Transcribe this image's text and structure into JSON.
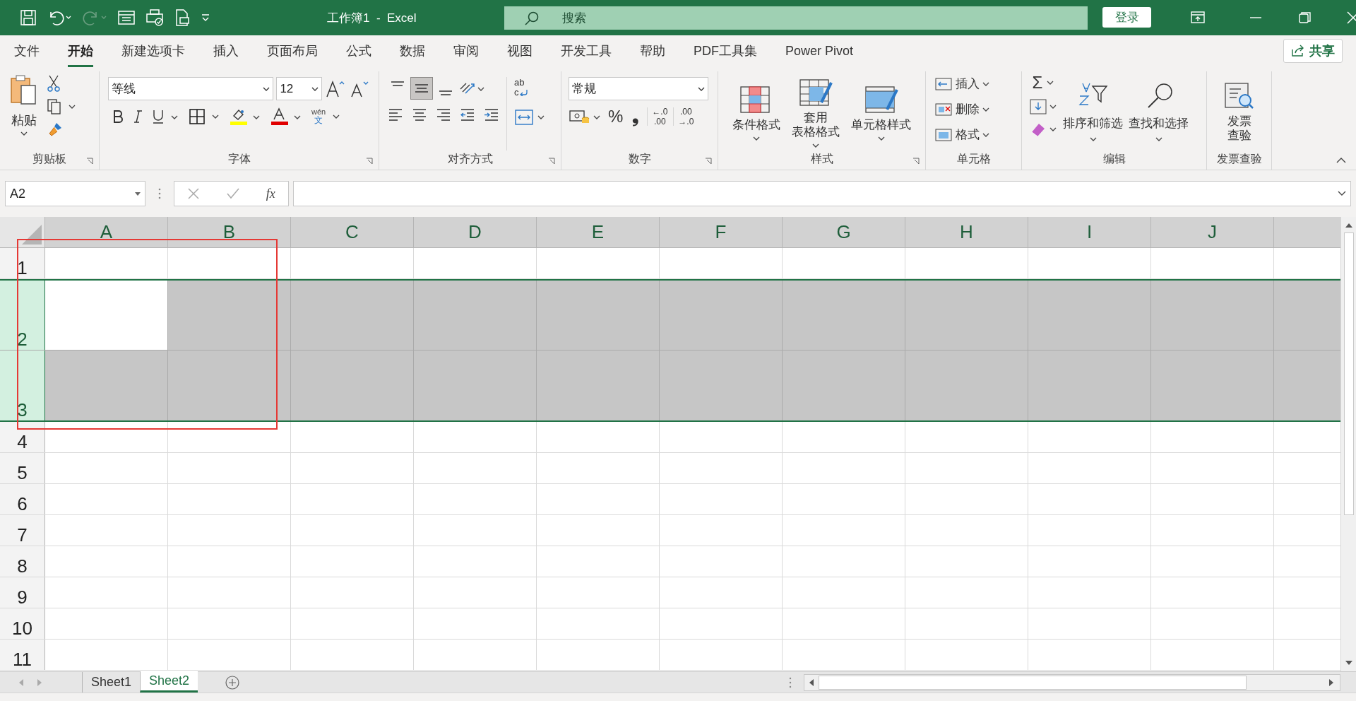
{
  "title_bar": {
    "title": "工作簿1  -  Excel",
    "search_placeholder": "搜索",
    "sign_in": "登录"
  },
  "ribbon_tabs": [
    {
      "label": "文件",
      "selected": false
    },
    {
      "label": "开始",
      "selected": true
    },
    {
      "label": "新建选项卡",
      "selected": false
    },
    {
      "label": "插入",
      "selected": false
    },
    {
      "label": "页面布局",
      "selected": false
    },
    {
      "label": "公式",
      "selected": false
    },
    {
      "label": "数据",
      "selected": false
    },
    {
      "label": "审阅",
      "selected": false
    },
    {
      "label": "视图",
      "selected": false
    },
    {
      "label": "开发工具",
      "selected": false
    },
    {
      "label": "帮助",
      "selected": false
    },
    {
      "label": "PDF工具集",
      "selected": false
    },
    {
      "label": "Power Pivot",
      "selected": false
    }
  ],
  "share": "共享",
  "clipboard": {
    "paste": "粘贴",
    "label": "剪贴板"
  },
  "font": {
    "font_name": "等线",
    "font_size": "12",
    "phonetic_top": "wén",
    "phonetic_bottom": "文",
    "label": "字体"
  },
  "alignment": {
    "vertical": [
      {
        "selected": false
      },
      {
        "selected": true
      },
      {
        "selected": false
      }
    ],
    "wrap_glyph": "ab",
    "wrap_glyph_2": "c",
    "label": "对齐方式"
  },
  "number": {
    "format": "常规",
    "percent": "%",
    "comma": "❟",
    "increase_decimal": [
      "←.0",
      ".00"
    ],
    "decrease_decimal": [
      ".00",
      "→.0"
    ],
    "label": "数字"
  },
  "styles": {
    "buttons": [
      [
        "条件格式"
      ],
      [
        "套用",
        "表格格式"
      ],
      [
        "单元格样式"
      ]
    ],
    "label": "样式"
  },
  "cells": {
    "buttons": [
      "插入",
      "删除",
      "格式"
    ],
    "label": "单元格"
  },
  "editing": {
    "sum": "Σ",
    "buttons": [
      "排序和筛选",
      "查找和选择"
    ],
    "label": "编辑"
  },
  "invoice": {
    "button": [
      "发票",
      "查验"
    ],
    "label": "发票查验"
  },
  "formula_bar": {
    "name_box": "A2",
    "fx": "fx"
  },
  "sheet": {
    "columns": [
      {
        "label": "A",
        "selected": true
      },
      {
        "label": "B",
        "selected": true
      },
      {
        "label": "C",
        "selected": true
      },
      {
        "label": "D",
        "selected": true
      },
      {
        "label": "E",
        "selected": true
      },
      {
        "label": "F",
        "selected": true
      },
      {
        "label": "G",
        "selected": true
      },
      {
        "label": "H",
        "selected": true
      },
      {
        "label": "I",
        "selected": true
      },
      {
        "label": "J",
        "selected": true
      }
    ],
    "rows": [
      {
        "label": "1",
        "selected": false
      },
      {
        "label": "2",
        "selected": true
      },
      {
        "label": "3",
        "selected": true
      },
      {
        "label": "4",
        "selected": false
      },
      {
        "label": "5",
        "selected": false
      },
      {
        "label": "6",
        "selected": false
      },
      {
        "label": "7",
        "selected": false
      },
      {
        "label": "8",
        "selected": false
      },
      {
        "label": "9",
        "selected": false
      },
      {
        "label": "10",
        "selected": false
      },
      {
        "label": "11",
        "selected": false
      }
    ]
  },
  "sheet_tabs": [
    {
      "label": "Sheet1",
      "selected": false
    },
    {
      "label": "Sheet2",
      "selected": true
    }
  ]
}
